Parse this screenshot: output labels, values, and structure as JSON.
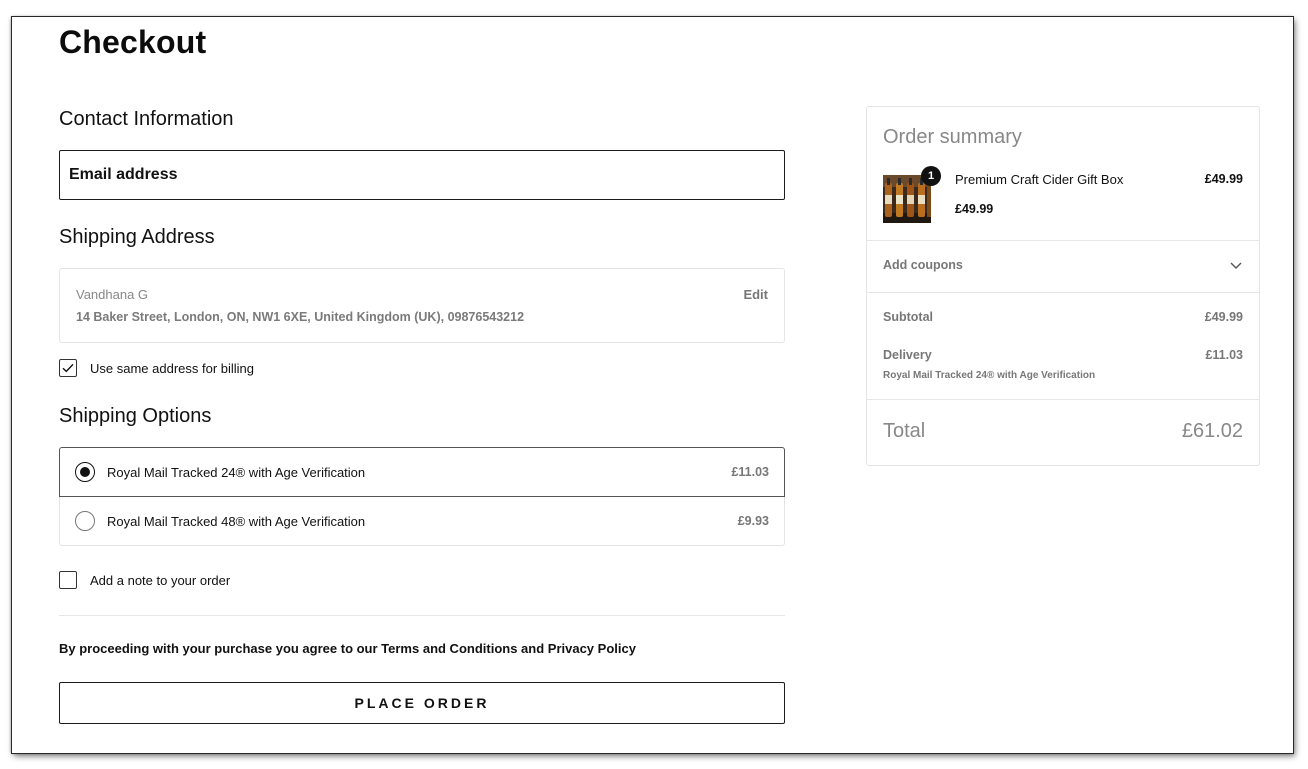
{
  "page": {
    "title": "Checkout"
  },
  "contact": {
    "title": "Contact Information",
    "email_placeholder": "Email address",
    "email_value": ""
  },
  "shipping_address": {
    "title": "Shipping Address",
    "name": "Vandhana G",
    "address": "14 Baker Street, London, ON, NW1 6XE, United Kingdom (UK), 09876543212",
    "edit_label": "Edit"
  },
  "billing": {
    "same_address_label": "Use same address for billing",
    "same_address_checked": true
  },
  "shipping_options": {
    "title": "Shipping Options",
    "options": [
      {
        "label": "Royal Mail Tracked 24® with Age Verification",
        "price": "£11.03",
        "selected": true
      },
      {
        "label": "Royal Mail Tracked 48® with Age Verification",
        "price": "£9.93",
        "selected": false
      }
    ]
  },
  "note": {
    "label": "Add a note to your order",
    "checked": false
  },
  "terms": {
    "text": "By proceeding with your purchase you agree to our Terms and Conditions and Privacy Policy"
  },
  "actions": {
    "place_order_label": "PLACE ORDER"
  },
  "order_summary": {
    "title": "Order summary",
    "item": {
      "name": "Premium Craft Cider Gift Box",
      "quantity": "1",
      "unit_price": "£49.99",
      "line_total": "£49.99"
    },
    "coupons_label": "Add coupons",
    "subtotal_label": "Subtotal",
    "subtotal_value": "£49.99",
    "delivery_label": "Delivery",
    "delivery_value": "£11.03",
    "delivery_method": "Royal Mail Tracked 24® with Age Verification",
    "total_label": "Total",
    "total_value": "£61.02"
  },
  "icons": {
    "checkbox_checked": "checkmark-icon",
    "chevron": "chevron-down-icon",
    "product_image": "cider-bottles-image"
  },
  "colors": {
    "text": "#111111",
    "muted": "#777777",
    "border": "#e4e4e4",
    "badge": "#111111"
  }
}
